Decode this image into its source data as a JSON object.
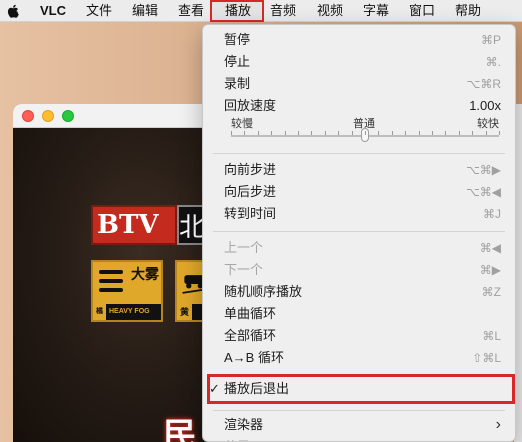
{
  "menubar": {
    "app_name": "VLC",
    "items": [
      "文件",
      "编辑",
      "查看",
      "播放",
      "音频",
      "视频",
      "字幕",
      "窗口",
      "帮助"
    ],
    "active": "播放"
  },
  "video": {
    "logo_text": "BTV",
    "logo_char": "北",
    "fog_big": "大雾",
    "fog_level": "橘",
    "fog_text": "HEAVY FOG",
    "road_level": "黄",
    "bottom_char": "民"
  },
  "menu": {
    "pause": {
      "label": "暂停",
      "shortcut": "⌘P"
    },
    "stop": {
      "label": "停止",
      "shortcut": "⌘."
    },
    "record": {
      "label": "录制",
      "shortcut": "⌥⌘R"
    },
    "speed": {
      "label": "回放速度",
      "value": "1.00x",
      "slow": "较慢",
      "normal": "普通",
      "fast": "较快",
      "level": 0.5
    },
    "step_forward": {
      "label": "向前步进",
      "shortcut": "⌥⌘▶"
    },
    "step_backward": {
      "label": "向后步进",
      "shortcut": "⌥⌘◀"
    },
    "goto_time": {
      "label": "转到时间",
      "shortcut": "⌘J"
    },
    "previous": {
      "label": "上一个",
      "shortcut": "⌘◀"
    },
    "next": {
      "label": "下一个",
      "shortcut": "⌘▶"
    },
    "shuffle": {
      "label": "随机顺序播放",
      "shortcut": "⌘Z"
    },
    "repeat_one": {
      "label": "单曲循环",
      "shortcut": ""
    },
    "repeat_all": {
      "label": "全部循环",
      "shortcut": "⌘L"
    },
    "ab_loop": {
      "label": "A→B 循环",
      "shortcut": "⇧⌘L"
    },
    "quit_after": {
      "label": "播放后退出",
      "checked": "✓"
    },
    "renderer": {
      "label": "渲染器",
      "arrow": "›"
    },
    "more": {
      "label": "节目"
    }
  },
  "colors": {
    "highlight": "#d62828",
    "menu_bg": "#efefef"
  }
}
